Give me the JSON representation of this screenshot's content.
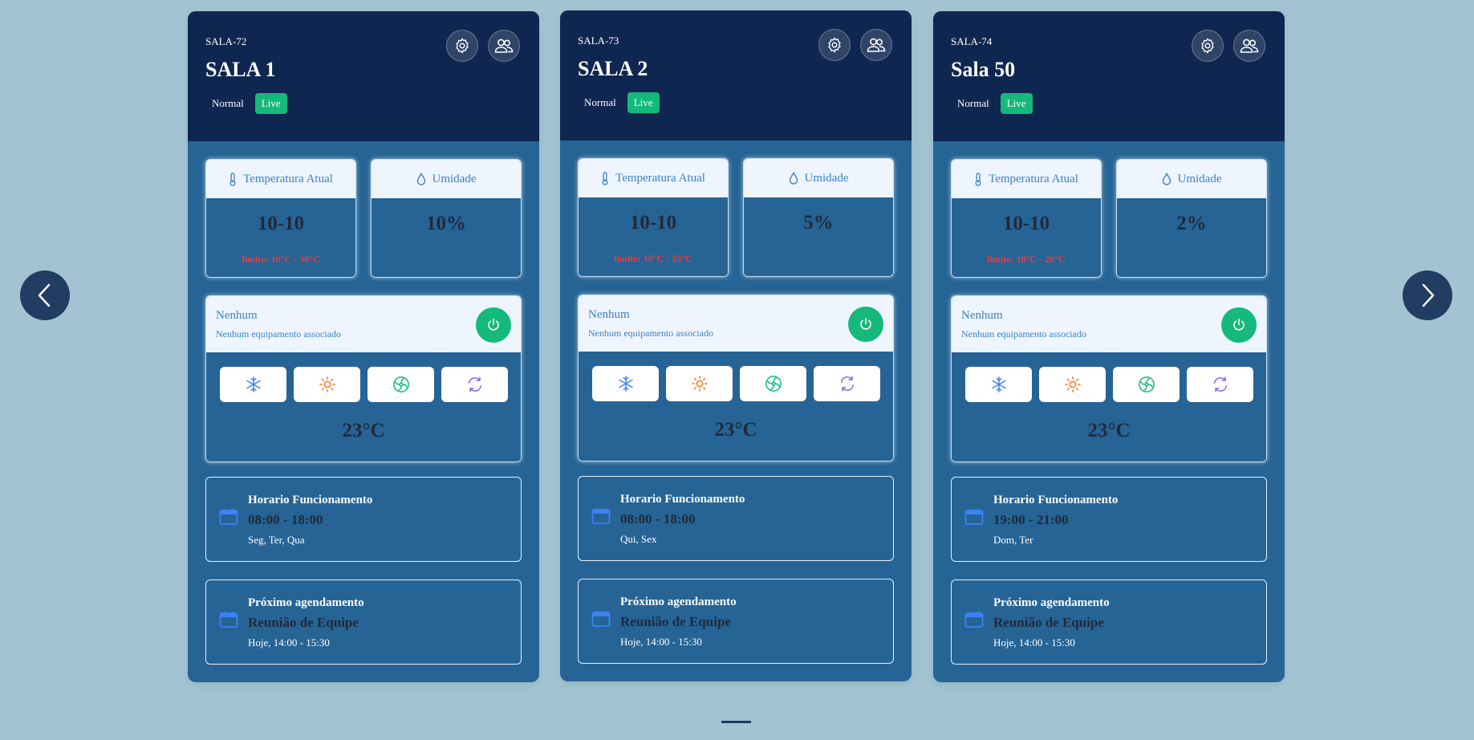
{
  "labels": {
    "temperature": "Temperatura Atual",
    "humidity": "Umidade",
    "hours_title": "Horario Funcionamento",
    "next_title": "Próximo agendamento"
  },
  "icons": {
    "prev": "chevron-left-icon",
    "next": "chevron-right-icon",
    "settings": "gear-icon",
    "users": "users-icon",
    "thermometer": "thermometer-icon",
    "droplet": "droplet-icon",
    "power": "power-icon",
    "cool": "snowflake-icon",
    "heat": "sun-icon",
    "fan": "fan-icon",
    "auto": "refresh-icon",
    "calendar": "calendar-icon"
  },
  "colors": {
    "background": "#a2c4d2",
    "header": "#0f2650",
    "card": "#266496",
    "live": "#15b97c",
    "limit": "#ef3a3a"
  },
  "rooms": [
    {
      "code": "SALA-72",
      "name": "SALA 1",
      "mode_badge": "Normal",
      "live_badge": "Live",
      "temperature": "10-10",
      "limit": "limite: 10°C - 30°C",
      "humidity": "10%",
      "equipment_name": "Nenhum",
      "equipment_desc": "Nenhum equipamento associado",
      "setpoint": "23°C",
      "hours": "08:00 - 18:00",
      "days": "Seg, Ter, Qua",
      "next_event": "Reunião de Equipe",
      "next_when": "Hoje, 14:00 - 15:30"
    },
    {
      "code": "SALA-73",
      "name": "SALA 2",
      "mode_badge": "Normal",
      "live_badge": "Live",
      "temperature": "10-10",
      "limit": "limite: 10°C - 25°C",
      "humidity": "5%",
      "equipment_name": "Nenhum",
      "equipment_desc": "Nenhum equipamento associado",
      "setpoint": "23°C",
      "hours": "08:00 - 18:00",
      "days": "Qui, Sex",
      "next_event": "Reunião de Equipe",
      "next_when": "Hoje, 14:00 - 15:30"
    },
    {
      "code": "SALA-74",
      "name": "Sala 50",
      "mode_badge": "Normal",
      "live_badge": "Live",
      "temperature": "10-10",
      "limit": "limite: 10°C - 20°C",
      "humidity": "2%",
      "equipment_name": "Nenhum",
      "equipment_desc": "Nenhum equipamento associado",
      "setpoint": "23°C",
      "hours": "19:00 - 21:00",
      "days": "Dom, Ter",
      "next_event": "Reunião de Equipe",
      "next_when": "Hoje, 14:00 - 15:30"
    }
  ]
}
